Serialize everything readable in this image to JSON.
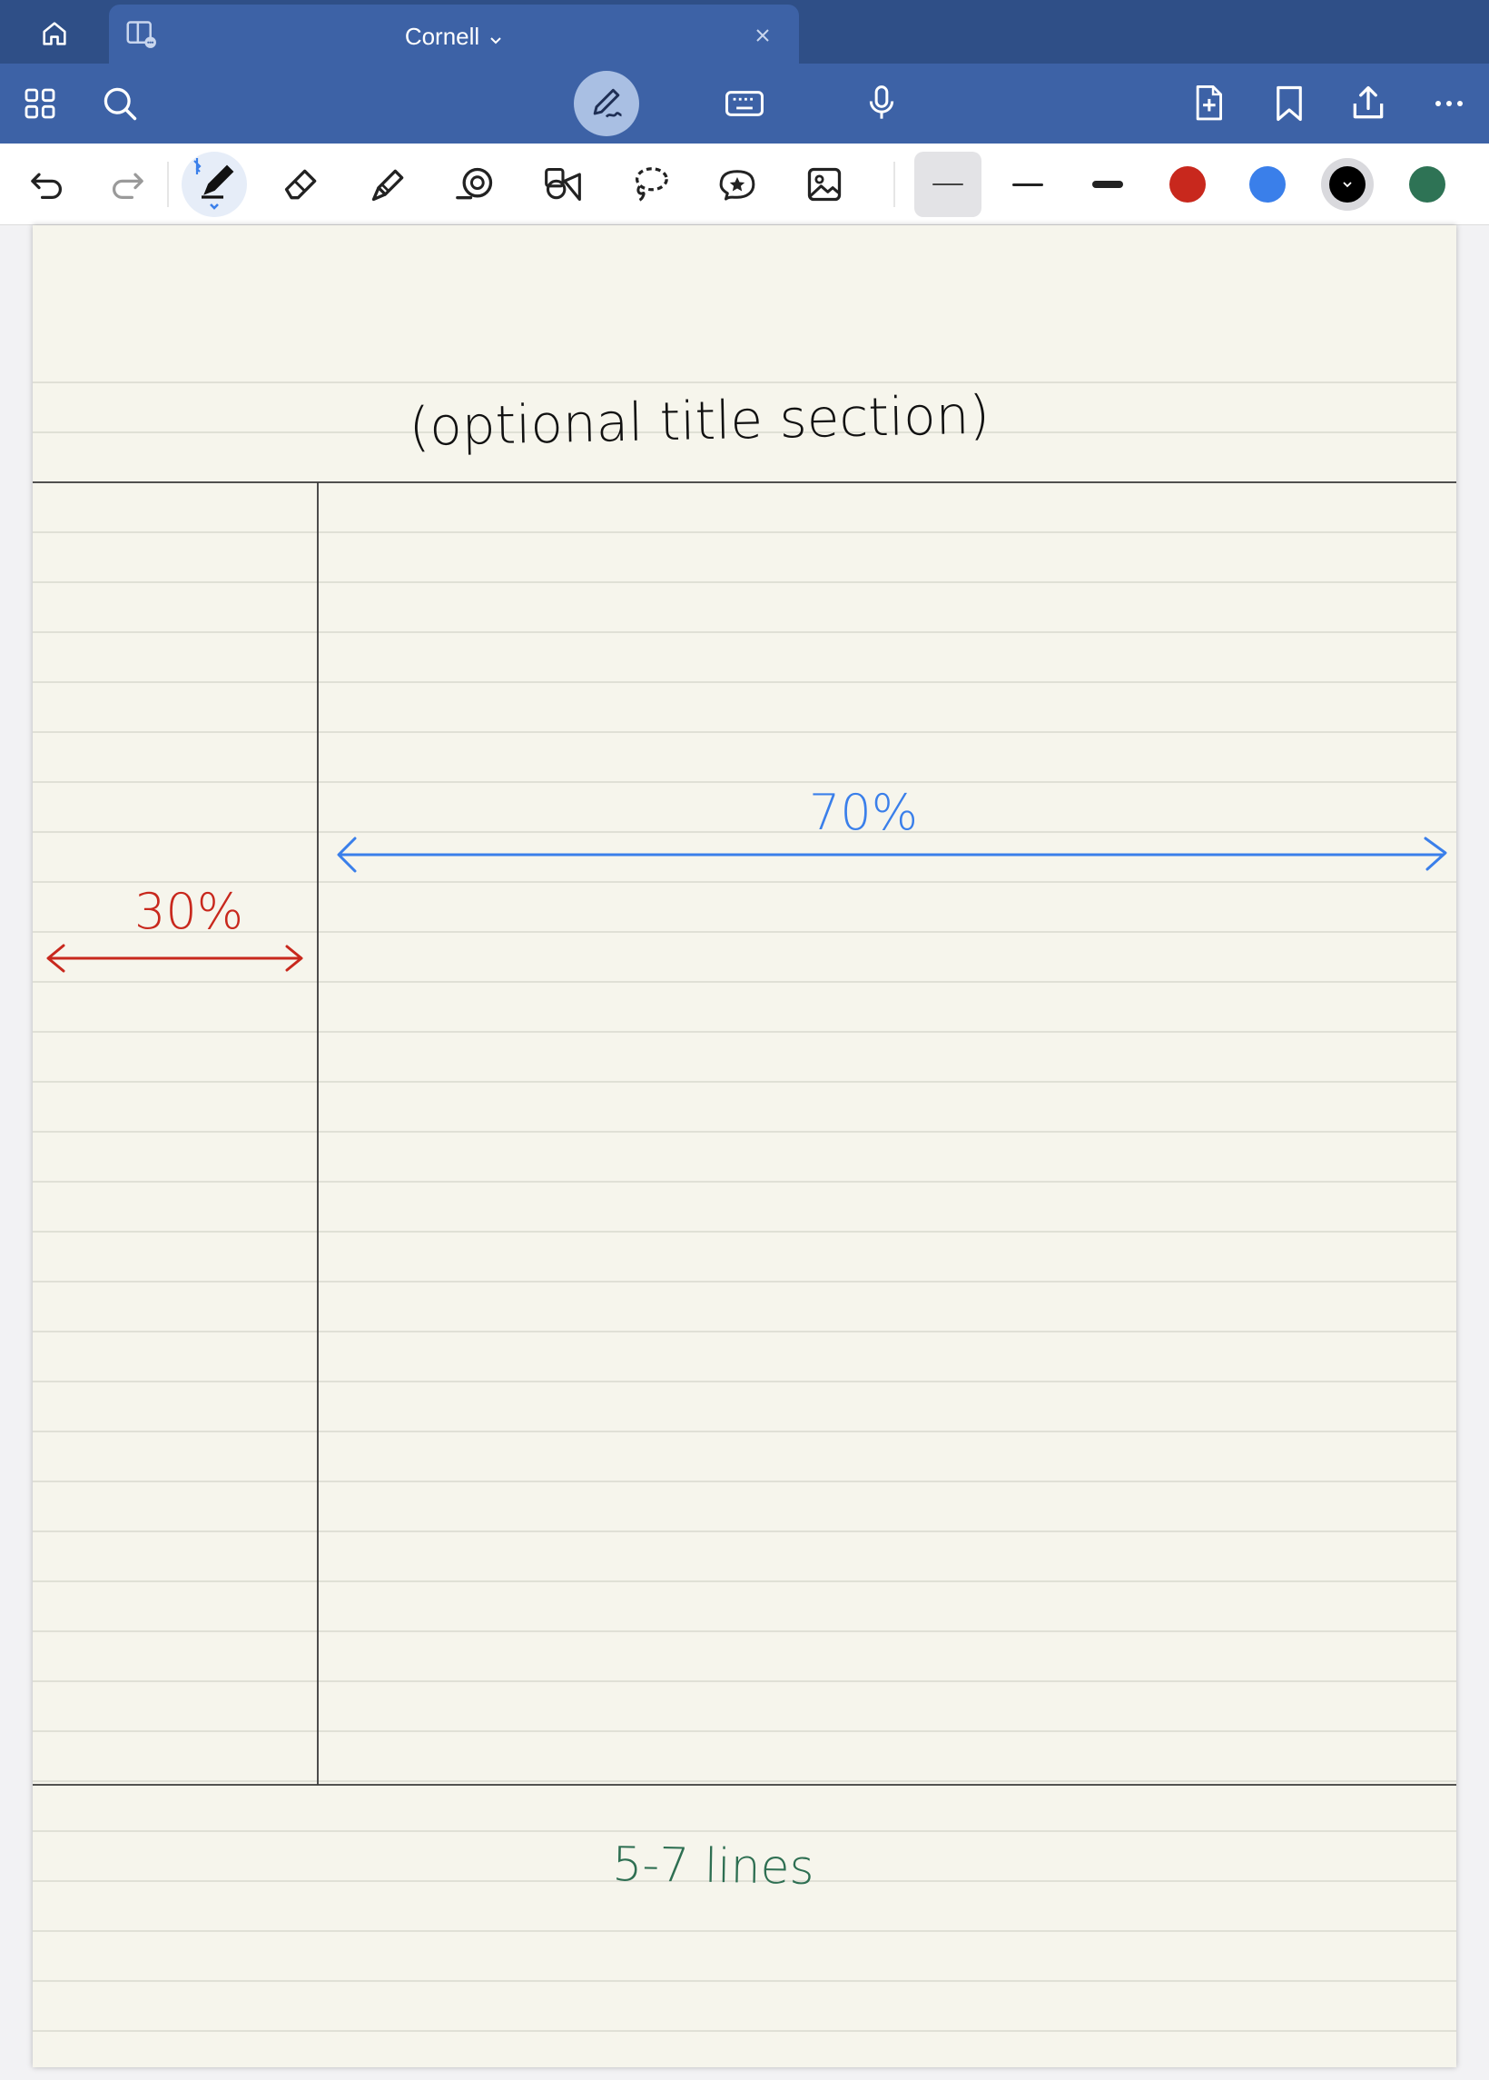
{
  "tab": {
    "title": "Cornell"
  },
  "toolbar": {
    "stroke_options": [
      "thin",
      "medium",
      "thick"
    ],
    "colors": [
      "#c8281d",
      "#3a7fea",
      "#000000",
      "#2e7355"
    ],
    "selected_color": "#000000"
  },
  "page": {
    "background": "#f6f5ec",
    "annotations": {
      "title_note": "(optional title section)",
      "cue_width": "30%",
      "notes_width": "70%",
      "summary_note": "5-7 lines"
    },
    "annotation_colors": {
      "title_note": "#111111",
      "cue_width": "#c8281d",
      "notes_width": "#3a7fea",
      "summary_note": "#2e6f52"
    }
  }
}
